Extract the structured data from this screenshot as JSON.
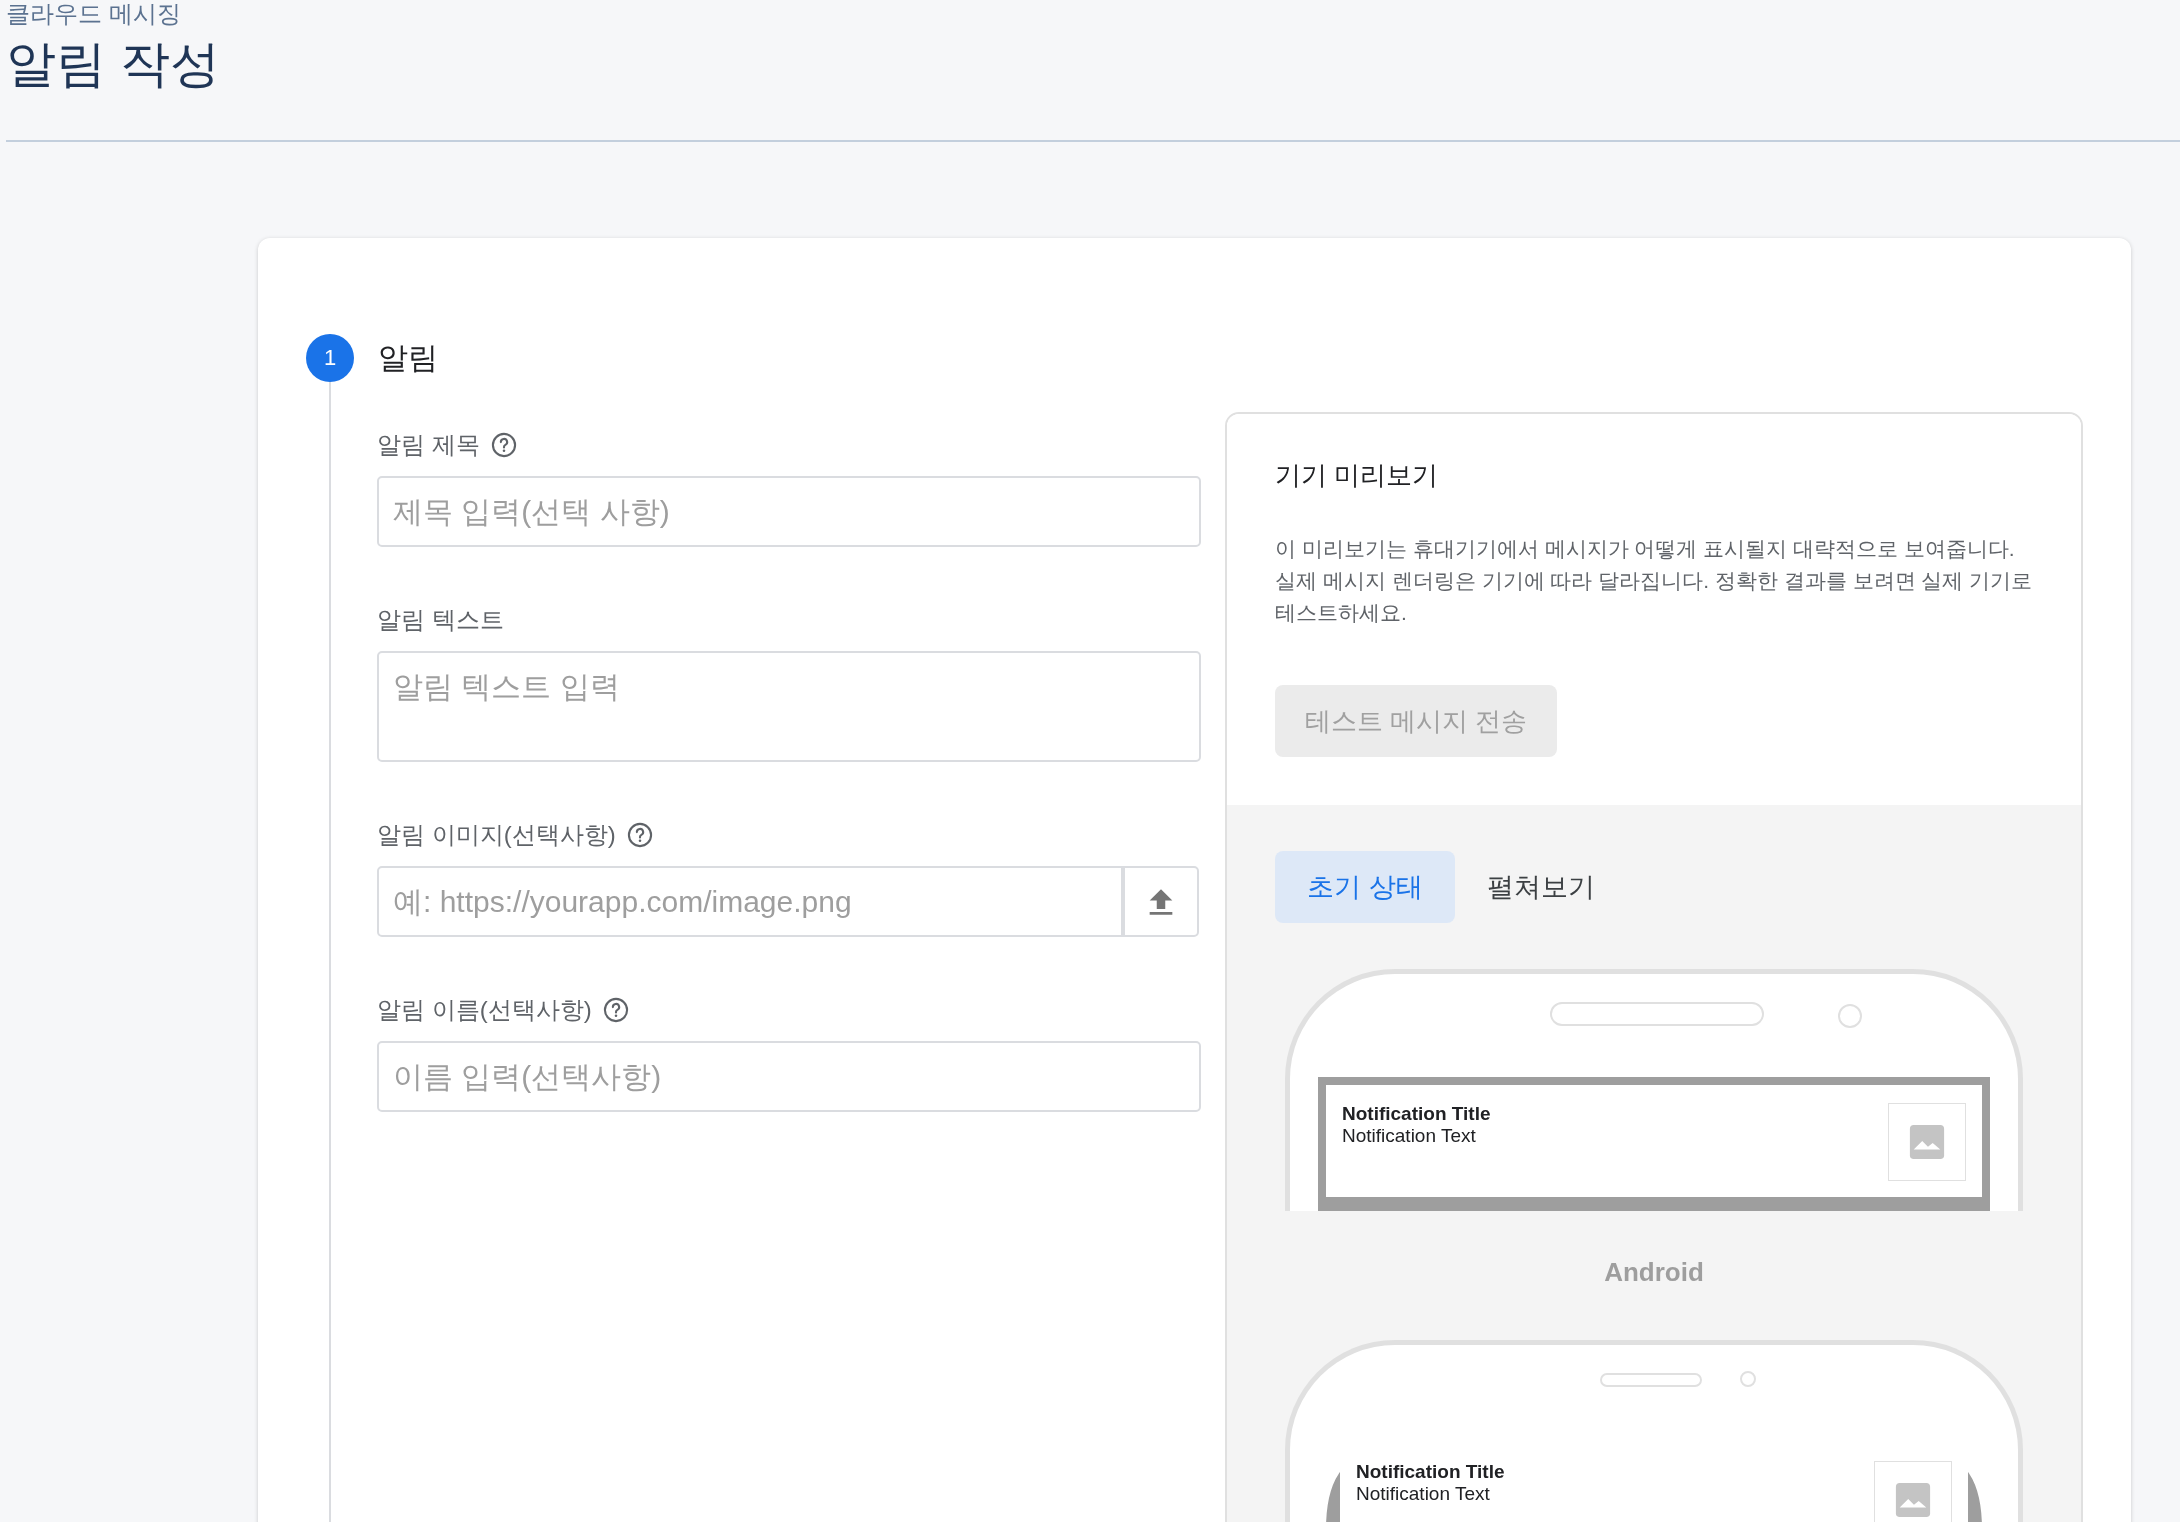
{
  "header": {
    "breadcrumb": "클라우드 메시징",
    "title": "알림 작성"
  },
  "step": {
    "number": "1",
    "title": "알림"
  },
  "fields": [
    {
      "kind": "input",
      "label": "알림 제목",
      "help": true,
      "placeholder": "제목 입력(선택 사항)"
    },
    {
      "kind": "textarea",
      "label": "알림 텍스트",
      "help": false,
      "placeholder": "알림 텍스트 입력"
    },
    {
      "kind": "upload",
      "label": "알림 이미지(선택사항)",
      "help": true,
      "placeholder": "예: https://yourapp.com/image.png"
    },
    {
      "kind": "input",
      "label": "알림 이름(선택사항)",
      "help": true,
      "placeholder": "이름 입력(선택사항)"
    }
  ],
  "preview": {
    "title": "기기 미리보기",
    "description": "이 미리보기는 휴대기기에서 메시지가 어떻게 표시될지 대략적으로 보여줍니다. 실제 메시지 렌더링은 기기에 따라 달라집니다. 정확한 결과를 보려면 실제 기기로 테스트하세요.",
    "test_button": {
      "label": "테스트 메시지 전송",
      "disabled": true
    },
    "tabs": [
      {
        "label": "초기 상태",
        "selected": true
      },
      {
        "label": "펼쳐보기",
        "selected": false
      }
    ],
    "devices": [
      {
        "kind": "android",
        "label": "Android",
        "notification": {
          "title": "Notification Title",
          "text": "Notification Text"
        }
      },
      {
        "kind": "notch",
        "notification": {
          "title": "Notification Title",
          "text": "Notification Text"
        }
      }
    ]
  }
}
